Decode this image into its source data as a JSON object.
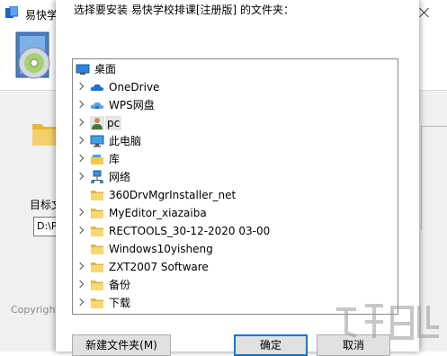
{
  "background_window": {
    "title": "易快学",
    "target_label": "目标文",
    "path_value": "D:\\P",
    "copyright": "Copyright"
  },
  "dialog": {
    "prompt": "选择要安装 易快学校排课[注册版] 的文件夹：",
    "tree": [
      {
        "label": "桌面",
        "icon": "desktop-icon",
        "expandable": false,
        "indent": 0
      },
      {
        "label": "OneDrive",
        "icon": "onedrive-cloud-icon",
        "expandable": true,
        "indent": 1
      },
      {
        "label": "WPS网盘",
        "icon": "wps-cloud-icon",
        "expandable": true,
        "indent": 1
      },
      {
        "label": "pc",
        "icon": "user-icon",
        "expandable": true,
        "indent": 1,
        "selected": true
      },
      {
        "label": "此电脑",
        "icon": "computer-icon",
        "expandable": true,
        "indent": 1
      },
      {
        "label": "库",
        "icon": "library-icon",
        "expandable": true,
        "indent": 1
      },
      {
        "label": "网络",
        "icon": "network-icon",
        "expandable": true,
        "indent": 1
      },
      {
        "label": "360DrvMgrInstaller_net",
        "icon": "folder-icon",
        "expandable": false,
        "indent": 1
      },
      {
        "label": "MyEditor_xiazaiba",
        "icon": "folder-icon",
        "expandable": true,
        "indent": 1
      },
      {
        "label": "RECTOOLS_30-12-2020 03-00",
        "icon": "folder-icon",
        "expandable": true,
        "indent": 1
      },
      {
        "label": "Windows10yisheng",
        "icon": "folder-icon",
        "expandable": false,
        "indent": 1
      },
      {
        "label": "ZXT2007 Software",
        "icon": "folder-icon",
        "expandable": true,
        "indent": 1
      },
      {
        "label": "备份",
        "icon": "folder-icon",
        "expandable": true,
        "indent": 1
      },
      {
        "label": "下载",
        "icon": "folder-icon",
        "expandable": true,
        "indent": 1
      }
    ],
    "buttons": {
      "new_folder": "新建文件夹(M)",
      "ok": "确定",
      "cancel": "取消"
    }
  },
  "colors": {
    "accent": "#0078d7",
    "folder": "#f5c84a",
    "selection": "#e5e5e5"
  }
}
